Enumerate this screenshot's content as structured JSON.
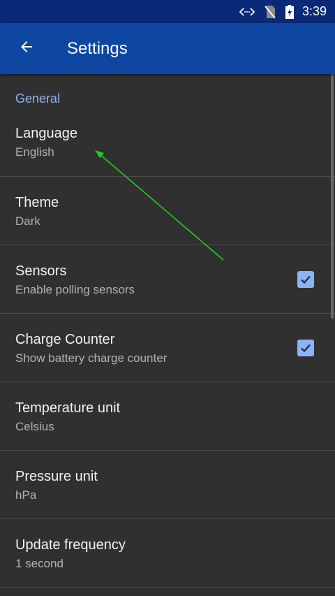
{
  "status_bar": {
    "time": "3:39",
    "icons": [
      "code-arrows-icon",
      "no-sim-icon",
      "battery-charging-icon"
    ]
  },
  "app_bar": {
    "title": "Settings",
    "back_icon": "arrow-back-icon"
  },
  "section": {
    "label": "General"
  },
  "preferences": [
    {
      "title": "Language",
      "summary": "English"
    },
    {
      "title": "Theme",
      "summary": "Dark"
    },
    {
      "title": "Sensors",
      "summary": "Enable polling sensors",
      "checked": true
    },
    {
      "title": "Charge Counter",
      "summary": "Show battery charge counter",
      "checked": true
    },
    {
      "title": "Temperature unit",
      "summary": "Celsius"
    },
    {
      "title": "Pressure unit",
      "summary": "hPa"
    },
    {
      "title": "Update frequency",
      "summary": "1 second"
    }
  ],
  "colors": {
    "app_bar": "#0d47a1",
    "status_bar": "#0a2a78",
    "background": "#303030",
    "accent": "#8ab4f8",
    "annotation_arrow": "#22cc22"
  }
}
